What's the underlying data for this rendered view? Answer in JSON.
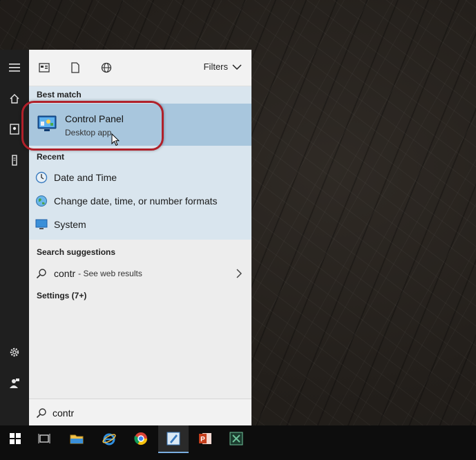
{
  "filters": {
    "label": "Filters"
  },
  "best_match": {
    "label": "Best match",
    "title": "Control Panel",
    "subtitle": "Desktop app"
  },
  "recent": {
    "label": "Recent",
    "items": [
      {
        "label": "Date and Time",
        "icon": "clock-icon"
      },
      {
        "label": "Change date, time, or number formats",
        "icon": "region-globe-icon"
      },
      {
        "label": "System",
        "icon": "monitor-icon"
      }
    ]
  },
  "suggestions": {
    "label": "Search suggestions",
    "query": "contr",
    "see_web": "- See web results"
  },
  "settings": {
    "label": "Settings (7+)"
  },
  "search": {
    "value": "contr"
  },
  "colors": {
    "highlight": "#a8c6dd",
    "outline": "#b0202a",
    "results_bg": "#d9e5ee"
  }
}
